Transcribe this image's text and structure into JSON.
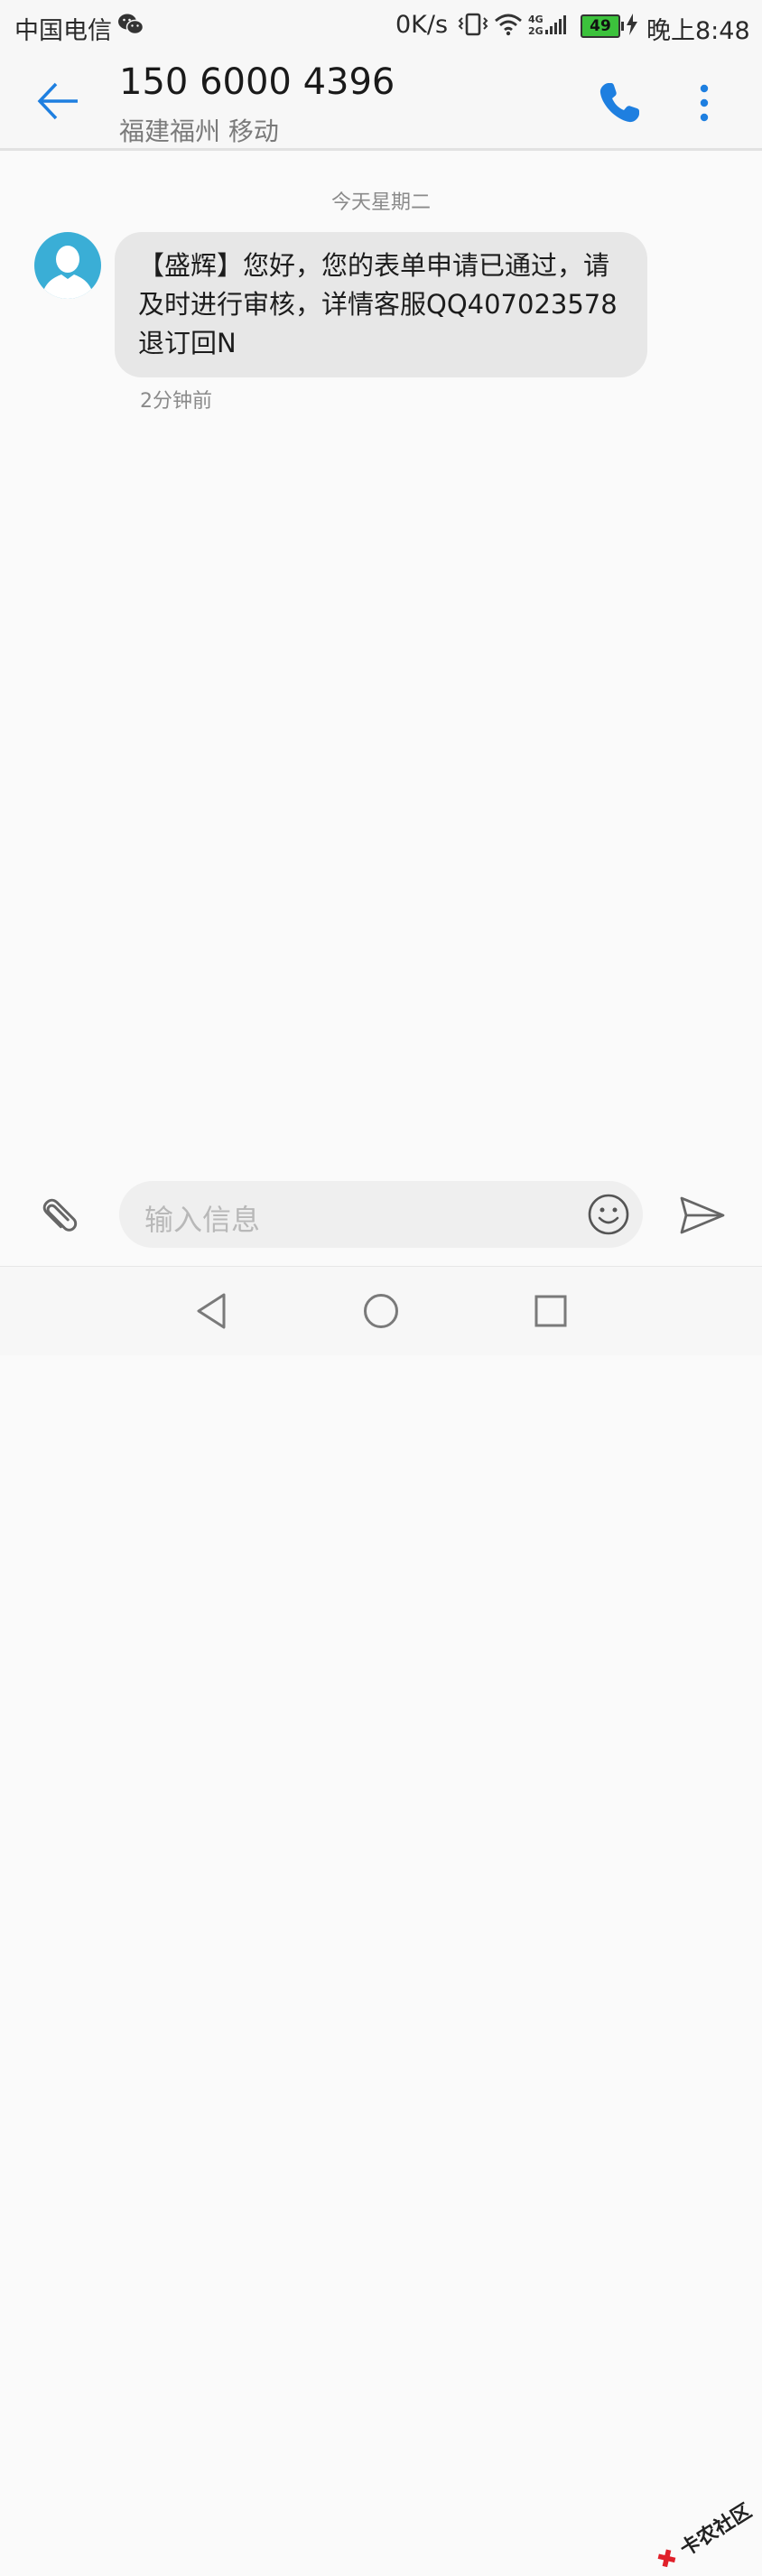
{
  "status_bar": {
    "carrier": "中国电信",
    "net_speed": "0K/s",
    "battery": "49",
    "time": "晚上8:48",
    "signal_labels": "4G 2G",
    "icons": [
      "wechat-icon",
      "vibrate-icon",
      "wifi-icon",
      "signal-icon",
      "battery-icon",
      "charging-icon"
    ]
  },
  "header": {
    "contact_number": "150 6000 4396",
    "contact_location": "福建福州 移动",
    "icons": [
      "back-arrow-icon",
      "phone-icon",
      "more-vert-icon"
    ]
  },
  "conversation": {
    "date_divider": "今天星期二",
    "messages": [
      {
        "text": "【盛辉】您好，您的表单申请已通过，请及时进行审核，详情客服QQ407023578退订回N",
        "time": "2分钟前"
      }
    ]
  },
  "composer": {
    "placeholder": "输入信息",
    "icons": [
      "paperclip-icon",
      "emoji-icon",
      "send-icon"
    ]
  },
  "nav_bar": {
    "icons": [
      "nav-back-icon",
      "nav-home-icon",
      "nav-recent-icon"
    ]
  },
  "watermark": {
    "text": "卡农社区"
  },
  "colors": {
    "accent": "#1e7fe0",
    "avatar_bg": "#3aaed6",
    "bubble_bg": "#e7e7e7",
    "battery_green": "#3cc23c",
    "watermark_red": "#e0202a"
  }
}
